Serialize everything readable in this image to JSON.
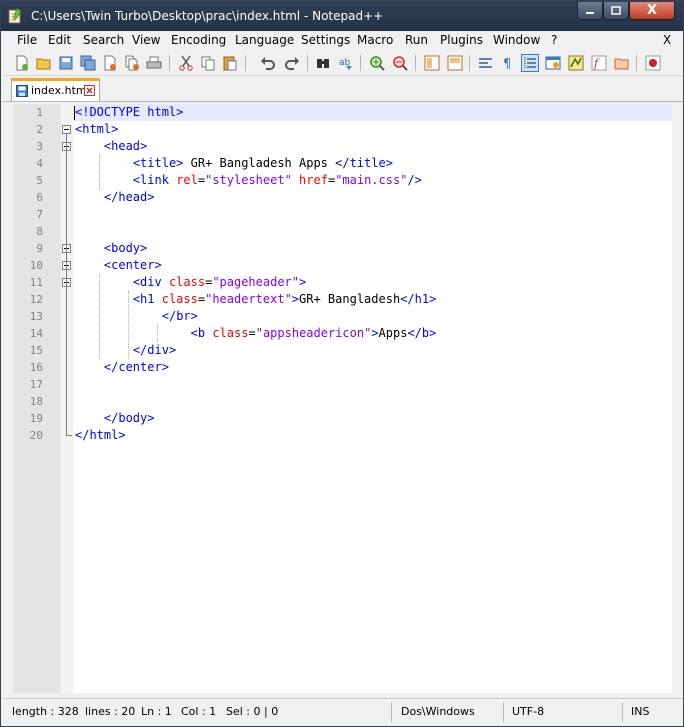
{
  "window": {
    "title": "C:\\Users\\Twin Turbo\\Desktop\\prac\\index.html - Notepad++",
    "close_glyph": "X"
  },
  "menu": {
    "items": [
      "File",
      "Edit",
      "Search",
      "View",
      "Encoding",
      "Language",
      "Settings",
      "Macro",
      "Run",
      "Plugins",
      "Window",
      "?"
    ],
    "close_label": "X"
  },
  "toolbar": {
    "buttons": [
      "new-file",
      "open-file",
      "save",
      "save-all",
      "close",
      "close-all",
      "print",
      "cut",
      "copy",
      "paste",
      "undo",
      "redo",
      "find",
      "replace",
      "zoom-in",
      "zoom-out",
      "sync-vertical",
      "sync-horizontal",
      "word-wrap",
      "show-all-chars",
      "indent-guide",
      "user-defined-language",
      "doc-map",
      "function-list",
      "folder-as-workspace",
      "record-macro"
    ],
    "active_button": "indent-guide"
  },
  "tabs": [
    {
      "title": "index.html",
      "active": true
    }
  ],
  "editor": {
    "line_numbers": [
      "1",
      "2",
      "3",
      "4",
      "5",
      "6",
      "7",
      "8",
      "9",
      "10",
      "11",
      "12",
      "13",
      "14",
      "15",
      "16",
      "17",
      "18",
      "19",
      "20"
    ],
    "current_line": 1,
    "lines": [
      {
        "indent": 0,
        "tokens": [
          [
            "t",
            "<!DOCTYPE html>"
          ]
        ]
      },
      {
        "indent": 0,
        "tokens": [
          [
            "t",
            "<html>"
          ]
        ]
      },
      {
        "indent": 4,
        "tokens": [
          [
            "t",
            "<head>"
          ]
        ]
      },
      {
        "indent": 8,
        "tokens": [
          [
            "t",
            "<title>"
          ],
          [
            "x",
            " GR+ Bangladesh Apps "
          ],
          [
            "t",
            "</title>"
          ]
        ]
      },
      {
        "indent": 8,
        "tokens": [
          [
            "t",
            "<link "
          ],
          [
            "a",
            "rel"
          ],
          [
            "x",
            "="
          ],
          [
            "v",
            "\"stylesheet\""
          ],
          [
            "x",
            " "
          ],
          [
            "a",
            "href"
          ],
          [
            "x",
            "="
          ],
          [
            "v",
            "\"main.css\""
          ],
          [
            "t",
            "/>"
          ]
        ]
      },
      {
        "indent": 4,
        "tokens": [
          [
            "t",
            "</head>"
          ]
        ]
      },
      {
        "indent": 0,
        "tokens": []
      },
      {
        "indent": 0,
        "tokens": []
      },
      {
        "indent": 4,
        "tokens": [
          [
            "t",
            "<body>"
          ]
        ]
      },
      {
        "indent": 4,
        "tokens": [
          [
            "t",
            "<center>"
          ]
        ]
      },
      {
        "indent": 8,
        "tokens": [
          [
            "t",
            "<div "
          ],
          [
            "a",
            "class"
          ],
          [
            "x",
            "="
          ],
          [
            "v",
            "\"pageheader\""
          ],
          [
            "t",
            ">"
          ]
        ]
      },
      {
        "indent": 8,
        "tokens": [
          [
            "t",
            "<h1 "
          ],
          [
            "a",
            "class"
          ],
          [
            "x",
            "="
          ],
          [
            "v",
            "\"headertext\""
          ],
          [
            "t",
            ">"
          ],
          [
            "x",
            "GR+ Bangladesh"
          ],
          [
            "t",
            "</h1>"
          ]
        ]
      },
      {
        "indent": 12,
        "tokens": [
          [
            "t",
            "</br>"
          ]
        ]
      },
      {
        "indent": 16,
        "tokens": [
          [
            "t",
            "<b "
          ],
          [
            "a",
            "class"
          ],
          [
            "x",
            "="
          ],
          [
            "v",
            "\"appsheadericon\""
          ],
          [
            "t",
            ">"
          ],
          [
            "x",
            "Apps"
          ],
          [
            "t",
            "</b>"
          ]
        ]
      },
      {
        "indent": 8,
        "tokens": [
          [
            "t",
            "</div>"
          ]
        ]
      },
      {
        "indent": 4,
        "tokens": [
          [
            "t",
            "</center>"
          ]
        ]
      },
      {
        "indent": 0,
        "tokens": []
      },
      {
        "indent": 0,
        "tokens": []
      },
      {
        "indent": 4,
        "tokens": [
          [
            "t",
            "</body>"
          ]
        ]
      },
      {
        "indent": 0,
        "tokens": [
          [
            "t",
            "</html>"
          ]
        ]
      }
    ]
  },
  "status": {
    "length": "length : 328",
    "lines": "lines : 20",
    "ln": "Ln : 1",
    "col": "Col : 1",
    "sel": "Sel : 0 | 0",
    "eol": "Dos\\Windows",
    "encoding": "UTF-8",
    "mode": "INS"
  },
  "colors": {
    "tag": "#0000ff",
    "attribute": "#ff0000",
    "value": "#8000ff",
    "tab_accent": "#f5a623"
  }
}
